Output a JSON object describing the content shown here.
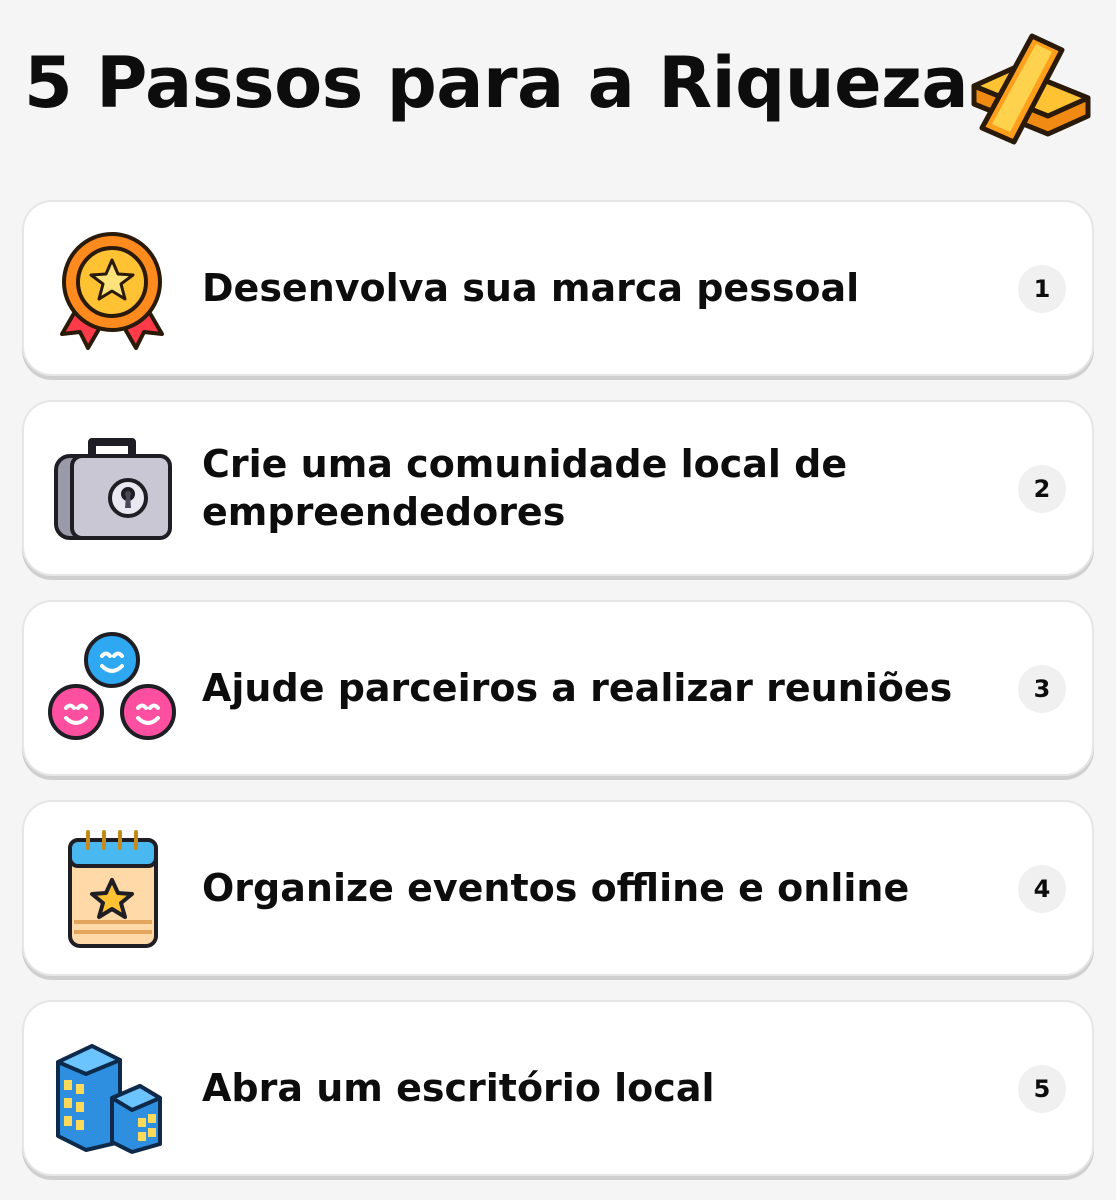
{
  "page": {
    "title": "5 Passos para a Riqueza",
    "title_icon": "gold-bars-icon"
  },
  "steps": [
    {
      "number": "1",
      "text": "Desenvolva sua marca pessoal",
      "icon": "medal-ribbon-icon"
    },
    {
      "number": "2",
      "text": "Crie uma comunidade local de empreendedores",
      "icon": "locked-briefcase-icon"
    },
    {
      "number": "3",
      "text": "Ajude parceiros a realizar reuniões",
      "icon": "smiling-people-icon"
    },
    {
      "number": "4",
      "text": "Organize eventos offline e online",
      "icon": "star-calendar-icon"
    },
    {
      "number": "5",
      "text": "Abra um escritório local",
      "icon": "office-buildings-icon"
    }
  ],
  "colors": {
    "background": "#f5f5f5",
    "card": "#ffffff",
    "badge": "#f0f0f0",
    "text": "#0d0d0d"
  }
}
